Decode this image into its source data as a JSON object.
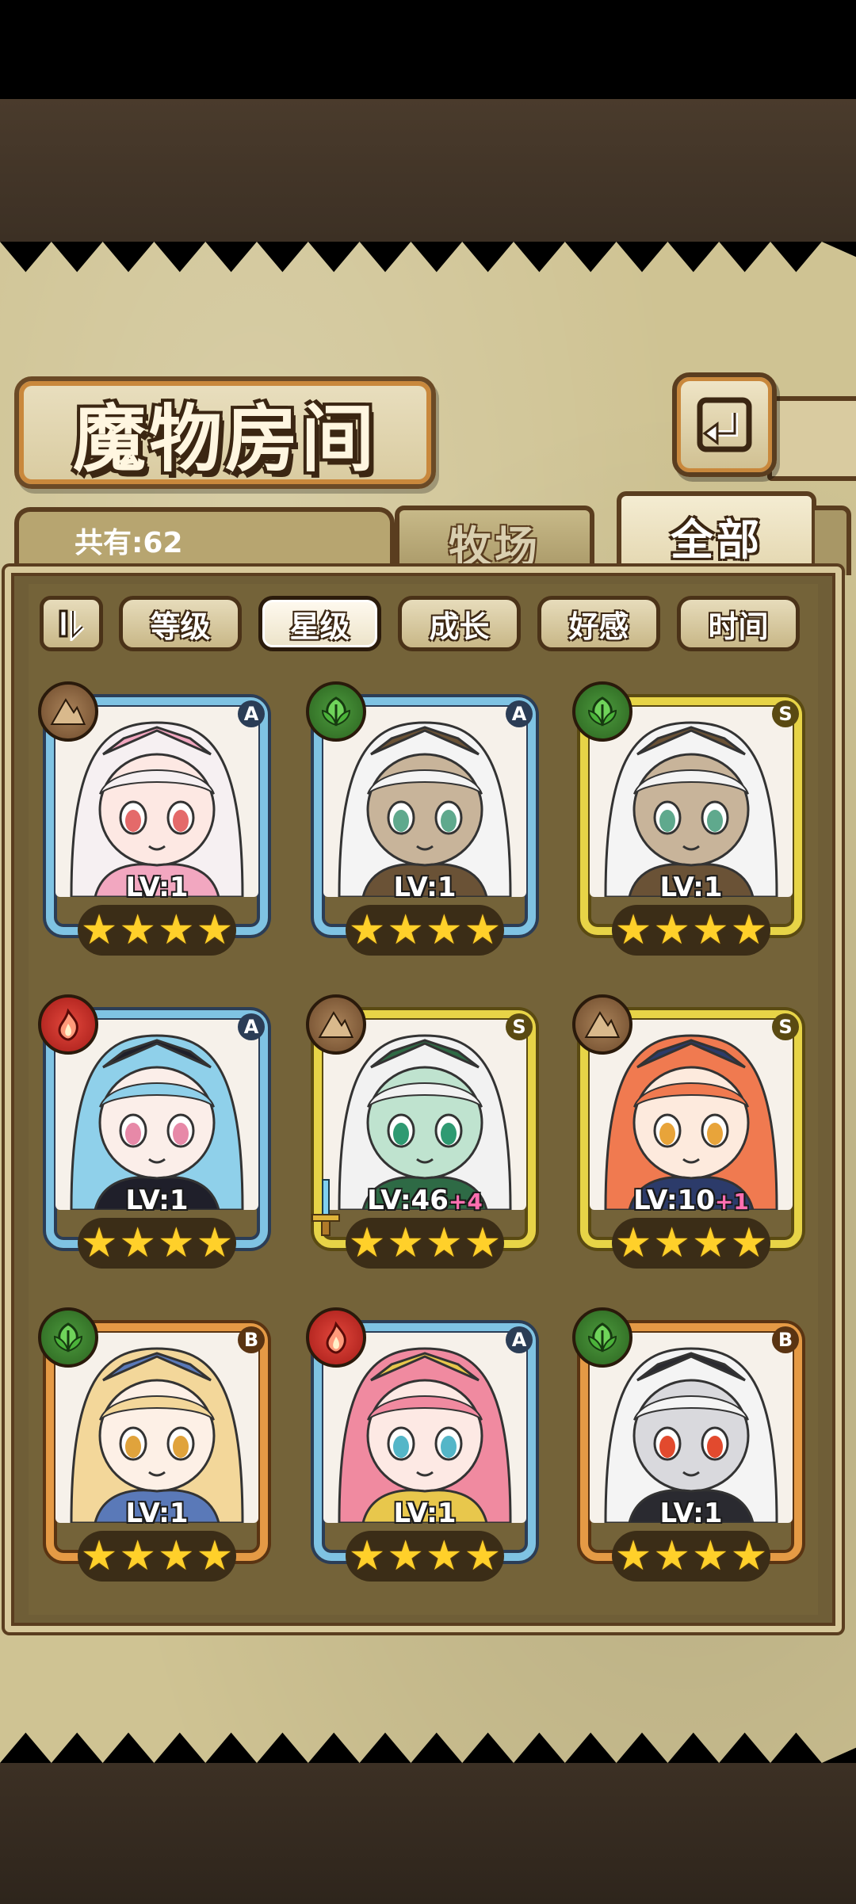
{
  "header": {
    "title": "魔物房间",
    "back_label": "返回"
  },
  "tabs": {
    "count_text": "共有:62",
    "items": [
      {
        "label": "牧场",
        "active": false
      },
      {
        "label": "全部",
        "active": true
      }
    ]
  },
  "sort": {
    "buttons": [
      {
        "label": "等级",
        "active": false
      },
      {
        "label": "星级",
        "active": true
      },
      {
        "label": "成长",
        "active": false
      },
      {
        "label": "好感",
        "active": false
      },
      {
        "label": "时间",
        "active": false
      }
    ]
  },
  "monsters": [
    {
      "element": "earth",
      "element_icon": "mountain-icon",
      "rank": "A",
      "level": "LV:1",
      "bonus": "",
      "stars": 4,
      "frame_color": "#7fc3e3",
      "portrait": {
        "hair": "#f6f0f2",
        "accent": "#f2a7c0",
        "skin": "#fde8e3",
        "eye": "#e46a6a"
      }
    },
    {
      "element": "nature",
      "element_icon": "leaf-icon",
      "rank": "A",
      "level": "LV:1",
      "bonus": "",
      "stars": 4,
      "frame_color": "#7fc3e3",
      "portrait": {
        "hair": "#f4f4f4",
        "accent": "#6a5236",
        "skin": "#c8b49a",
        "eye": "#5fa98d"
      }
    },
    {
      "element": "nature",
      "element_icon": "leaf-icon",
      "rank": "S",
      "level": "LV:1",
      "bonus": "",
      "stars": 4,
      "frame_color": "#e7d447",
      "portrait": {
        "hair": "#f4f4f4",
        "accent": "#6a5236",
        "skin": "#c8b49a",
        "eye": "#5fa98d"
      }
    },
    {
      "element": "fire",
      "element_icon": "flame-icon",
      "rank": "A",
      "level": "LV:1",
      "bonus": "",
      "stars": 4,
      "frame_color": "#7fc3e3",
      "portrait": {
        "hair": "#8fd0ea",
        "accent": "#1f1f2a",
        "skin": "#fbeee9",
        "eye": "#e789a8"
      }
    },
    {
      "element": "earth",
      "element_icon": "mountain-icon",
      "rank": "S",
      "level": "LV:46",
      "bonus": "+4",
      "stars": 4,
      "frame_color": "#e7d447",
      "portrait": {
        "hair": "#f2f2f2",
        "accent": "#2e6a45",
        "skin": "#bfe3cf",
        "eye": "#2f9a72"
      }
    },
    {
      "element": "earth",
      "element_icon": "mountain-icon",
      "rank": "S",
      "level": "LV:10",
      "bonus": "+1",
      "stars": 4,
      "frame_color": "#e7d447",
      "portrait": {
        "hair": "#f07a50",
        "accent": "#2c3b6a",
        "skin": "#fdeadd",
        "eye": "#e8a43a"
      }
    },
    {
      "element": "nature",
      "element_icon": "leaf-icon",
      "rank": "B",
      "level": "LV:1",
      "bonus": "",
      "stars": 4,
      "frame_color": "#e59a45",
      "portrait": {
        "hair": "#f3d79a",
        "accent": "#5a79b8",
        "skin": "#fdf0e6",
        "eye": "#e0a33c"
      }
    },
    {
      "element": "fire",
      "element_icon": "flame-icon",
      "rank": "A",
      "level": "LV:1",
      "bonus": "",
      "stars": 4,
      "frame_color": "#7fc3e3",
      "portrait": {
        "hair": "#f08aa0",
        "accent": "#e8c74c",
        "skin": "#fde9e4",
        "eye": "#54b6c8"
      }
    },
    {
      "element": "nature",
      "element_icon": "leaf-icon",
      "rank": "B",
      "level": "LV:1",
      "bonus": "",
      "stars": 4,
      "frame_color": "#e59a45",
      "portrait": {
        "hair": "#f4f4f4",
        "accent": "#2a2a30",
        "skin": "#d9d9dd",
        "eye": "#e24a2e"
      }
    }
  ]
}
